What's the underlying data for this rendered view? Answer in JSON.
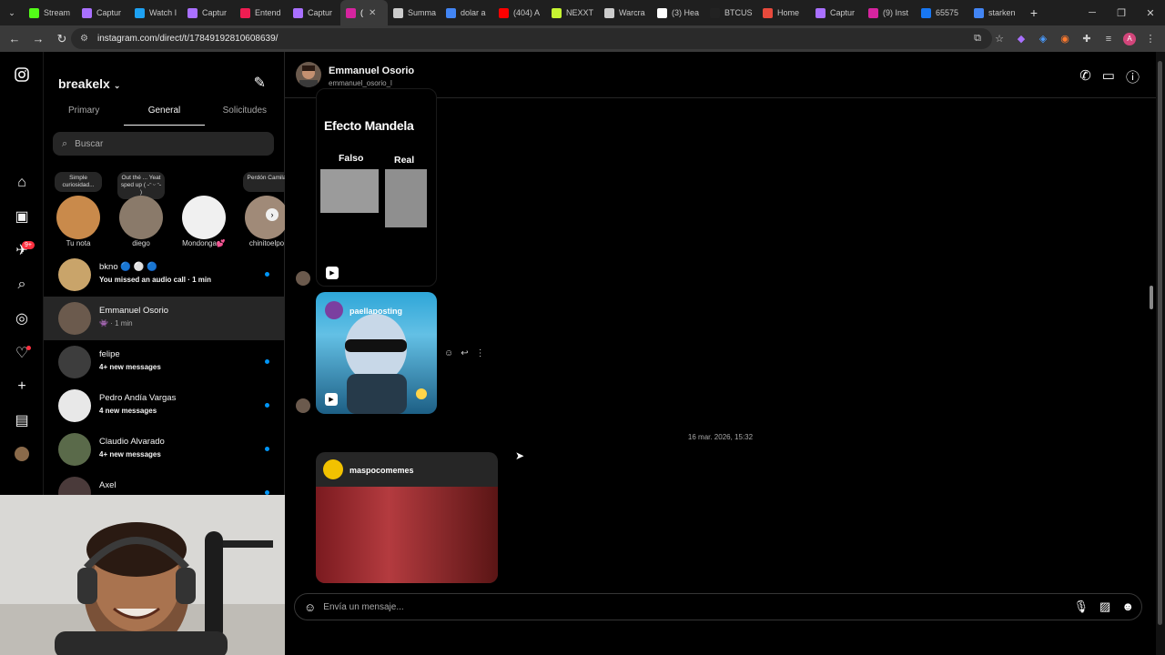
{
  "browser": {
    "tabs": [
      {
        "label": "Stream",
        "color": "#53fc18"
      },
      {
        "label": "Captur",
        "color": "#a970ff"
      },
      {
        "label": "Watch I",
        "color": "#1da1f2"
      },
      {
        "label": "Captur",
        "color": "#a970ff"
      },
      {
        "label": "Entend",
        "color": "#ee1d52"
      },
      {
        "label": "Captur",
        "color": "#a970ff"
      },
      {
        "label": "(",
        "color": "#d6249f",
        "active": true
      },
      {
        "label": "Summa",
        "color": "#cccccc"
      },
      {
        "label": "dolar a",
        "color": "#4285f4"
      },
      {
        "label": "(404) A",
        "color": "#ff0000"
      },
      {
        "label": "NEXXT",
        "color": "#c6f432"
      },
      {
        "label": "Warcra",
        "color": "#cccccc"
      },
      {
        "label": "(3) Hea",
        "color": "#ffffff"
      },
      {
        "label": "BTCUS",
        "color": "#222222"
      },
      {
        "label": "Home",
        "color": "#e84a3c"
      },
      {
        "label": "Captur",
        "color": "#a970ff"
      },
      {
        "label": "(9) Inst",
        "color": "#d6249f"
      },
      {
        "label": "65575",
        "color": "#1877f2"
      },
      {
        "label": "starken",
        "color": "#4285f4"
      }
    ],
    "url": "instagram.com/direct/t/17849192810608639/"
  },
  "inbox": {
    "account": "breakelx",
    "tabs": [
      "Primary",
      "General",
      "Solicitudes"
    ],
    "active_tab": "General",
    "search_placeholder": "Buscar",
    "notes": [
      {
        "bubble": "Simple curiosidad...",
        "name": "Tu nota",
        "color": "#c98a4b"
      },
      {
        "bubble": "Out thé ... Yeat sped up ( ˶ᵔ ᵕ ᵔ˶ )",
        "name": "diego",
        "color": "#8a7a6a"
      },
      {
        "bubble": "",
        "name": "Mondonga💕",
        "color": "#f0f0f0"
      },
      {
        "bubble": "Perdón Camila",
        "name": "chinitoelpo",
        "color": "#a08a78"
      }
    ],
    "conversations": [
      {
        "name": "bkno 🔵 ⚪ 🔵",
        "sub": "You missed an audio call · 1 min",
        "unread": true,
        "selected": false,
        "color": "#c9a46a"
      },
      {
        "name": "Emmanuel Osorio",
        "sub": "👾 · 1 min",
        "unread": false,
        "selected": true,
        "color": "#6b5a4d"
      },
      {
        "name": "felipe",
        "sub": "4+ new messages",
        "unread": true,
        "selected": false,
        "color": "#3d3d3d"
      },
      {
        "name": "Pedro Andía Vargas",
        "sub": "4 new messages",
        "unread": true,
        "selected": false,
        "color": "#e8e8e8"
      },
      {
        "name": "Claudio Alvarado",
        "sub": "4+ new messages",
        "unread": true,
        "selected": false,
        "color": "#5a6a4a"
      },
      {
        "name": "Axel",
        "sub": "4+ new messages",
        "unread": true,
        "selected": false,
        "color": "#4a3a3a"
      }
    ]
  },
  "rail": {
    "notification_badge": "9+"
  },
  "chat": {
    "name": "Emmanuel Osorio",
    "username": "emmanuel_osorio_l",
    "reel1": {
      "title": "Efecto Mandela",
      "label_a": "Falso",
      "label_b": "Real"
    },
    "reel2": {
      "owner": "paellaposting"
    },
    "date_separator": "16 mar. 2026, 15:32",
    "post": {
      "owner": "maspocomemes"
    },
    "composer_placeholder": "Envía un mensaje..."
  }
}
